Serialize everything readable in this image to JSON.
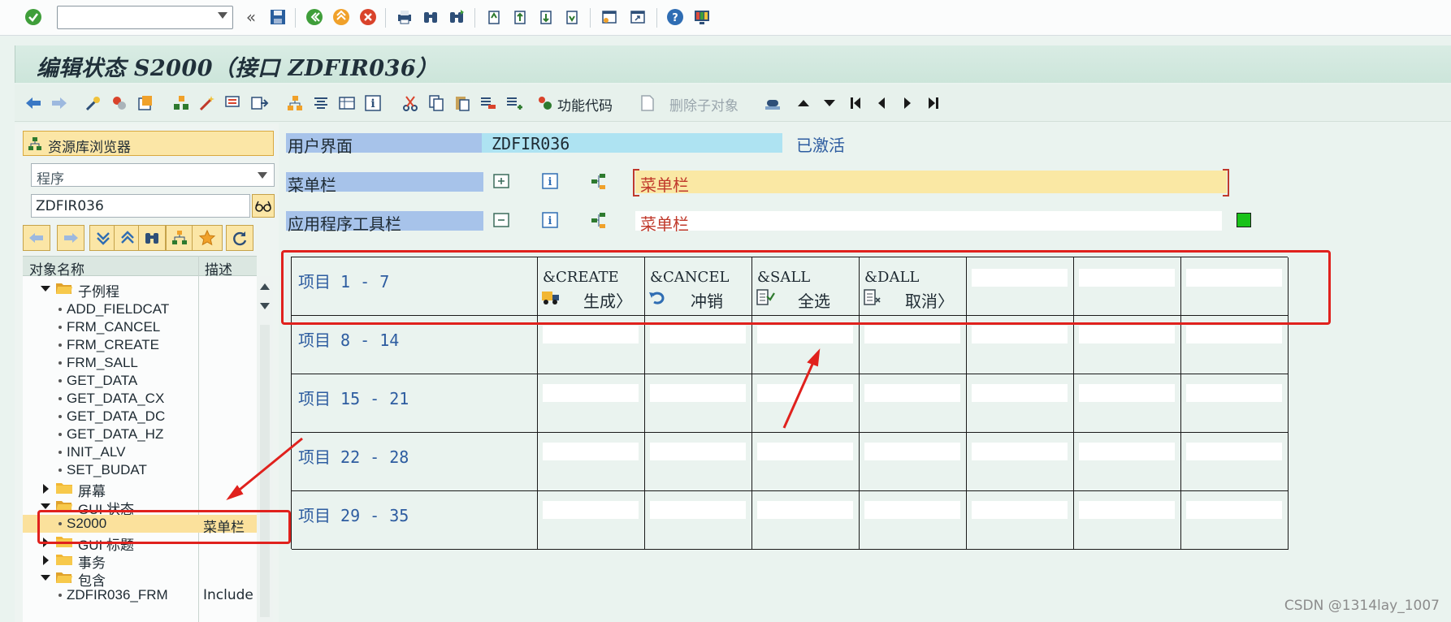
{
  "title": "编辑状态 S2000（接口 ZDFIR036）",
  "toolbar": {
    "command_field_value": "",
    "function_code_label": "功能代码",
    "delete_sub_label": "删除子对象"
  },
  "nav": {
    "repository_browser": "资源库浏览器",
    "object_type": "程序",
    "object_name": "ZDFIR036",
    "col_name": "对象名称",
    "col_desc": "描述"
  },
  "tree": [
    {
      "label": "子例程",
      "level": 1,
      "kind": "folder",
      "expanded": true,
      "desc": ""
    },
    {
      "label": "ADD_FIELDCAT",
      "level": 2,
      "kind": "item",
      "desc": ""
    },
    {
      "label": "FRM_CANCEL",
      "level": 2,
      "kind": "item",
      "desc": ""
    },
    {
      "label": "FRM_CREATE",
      "level": 2,
      "kind": "item",
      "desc": ""
    },
    {
      "label": "FRM_SALL",
      "level": 2,
      "kind": "item",
      "desc": ""
    },
    {
      "label": "GET_DATA",
      "level": 2,
      "kind": "item",
      "desc": ""
    },
    {
      "label": "GET_DATA_CX",
      "level": 2,
      "kind": "item",
      "desc": ""
    },
    {
      "label": "GET_DATA_DC",
      "level": 2,
      "kind": "item",
      "desc": ""
    },
    {
      "label": "GET_DATA_HZ",
      "level": 2,
      "kind": "item",
      "desc": ""
    },
    {
      "label": "INIT_ALV",
      "level": 2,
      "kind": "item",
      "desc": ""
    },
    {
      "label": "SET_BUDAT",
      "level": 2,
      "kind": "item",
      "desc": ""
    },
    {
      "label": "屏幕",
      "level": 1,
      "kind": "folder",
      "expanded": false,
      "desc": ""
    },
    {
      "label": "GUI 状态",
      "level": 1,
      "kind": "folder",
      "expanded": true,
      "desc": ""
    },
    {
      "label": "S2000",
      "level": 2,
      "kind": "item",
      "desc": "菜单栏",
      "selected": true
    },
    {
      "label": "GUI 标题",
      "level": 1,
      "kind": "folder",
      "expanded": false,
      "desc": ""
    },
    {
      "label": "事务",
      "level": 1,
      "kind": "folder",
      "expanded": false,
      "desc": ""
    },
    {
      "label": "包含",
      "level": 1,
      "kind": "folder",
      "expanded": true,
      "desc": ""
    },
    {
      "label": "ZDFIR036_FRM",
      "level": 2,
      "kind": "item",
      "desc": "Include"
    }
  ],
  "main": {
    "user_interface_label": "用户界面",
    "user_interface_value": "ZDFIR036",
    "status": "已激活",
    "menubar_label": "菜单栏",
    "menubar_value": "菜单栏",
    "apptoolbar_label": "应用程序工具栏",
    "apptoolbar_value": "菜单栏"
  },
  "grid": {
    "rows": [
      "项目  1 -  7",
      "项目  8 - 14",
      "项目 15 - 21",
      "项目 22 - 28",
      "项目 29 - 35"
    ],
    "functions": [
      {
        "code": "&CREATE",
        "text": "生成",
        "icon": "truck-icon",
        "more": "〉"
      },
      {
        "code": "&CANCEL",
        "text": "冲销",
        "icon": "undo-icon",
        "more": ""
      },
      {
        "code": "&SALL",
        "text": "全选",
        "icon": "select-all-icon",
        "more": ""
      },
      {
        "code": "&DALL",
        "text": "取消",
        "icon": "deselect-all-icon",
        "more": "〉"
      }
    ]
  },
  "watermark": "CSDN @1314lay_1007",
  "colors": {
    "accent_label": "#a7c3ea",
    "highlight": "#fbe6a6",
    "annotation": "#e0211d",
    "status_text": "#2d5ca0"
  }
}
